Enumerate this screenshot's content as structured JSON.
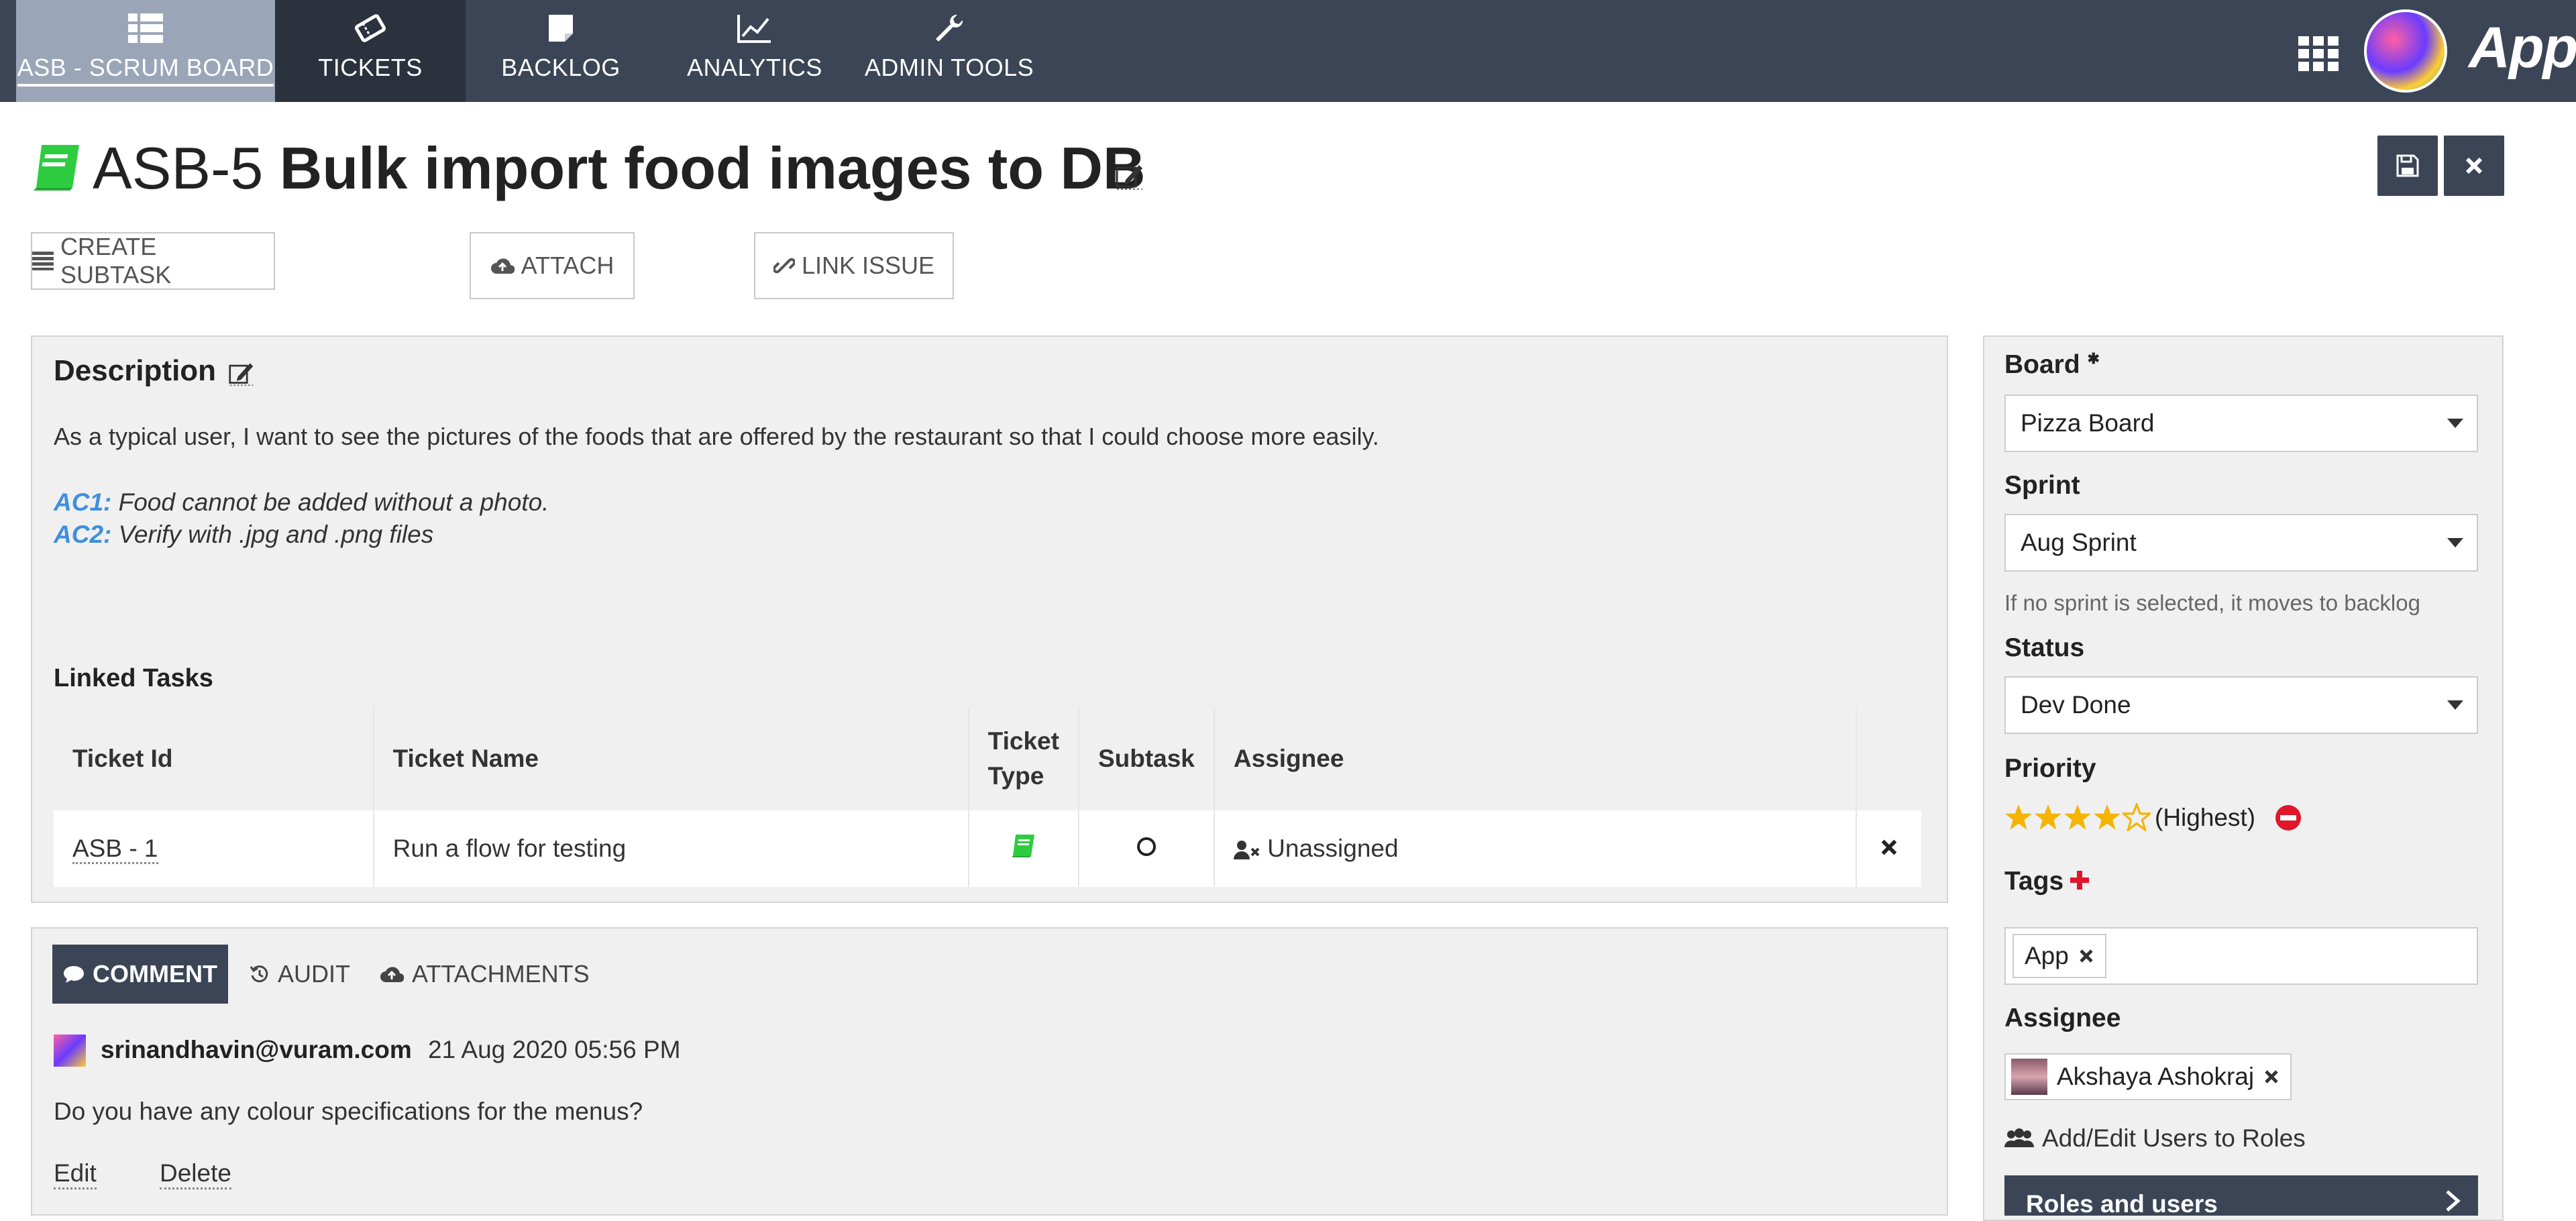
{
  "nav": {
    "items": [
      {
        "label": "ASB - SCRUM BOARD",
        "icon": "list-grid-icon"
      },
      {
        "label": "TICKETS",
        "icon": "ticket-icon"
      },
      {
        "label": "BACKLOG",
        "icon": "note-icon"
      },
      {
        "label": "ANALYTICS",
        "icon": "line-chart-icon"
      },
      {
        "label": "ADMIN TOOLS",
        "icon": "wrench-icon"
      }
    ],
    "brand": "Appia"
  },
  "ticket": {
    "id": "ASB-5",
    "name": "Bulk import food images to DB"
  },
  "actions": {
    "create_subtask": "CREATE SUBTASK",
    "attach": "ATTACH",
    "link_issue": "LINK ISSUE"
  },
  "description": {
    "heading": "Description",
    "text": "As a typical user, I want to see the pictures of the foods that are offered by the restaurant so that I could choose more easily.",
    "ac1_label": "AC1:",
    "ac1_text": " Food cannot be added without a photo.",
    "ac2_label": "AC2:",
    "ac2_text": " Verify with .jpg and .png files"
  },
  "linked": {
    "heading": "Linked Tasks",
    "columns": [
      "Ticket Id",
      "Ticket Name",
      "Ticket Type",
      "Subtask",
      "Assignee"
    ],
    "rows": [
      {
        "id": "ASB - 1",
        "name": "Run a flow for testing",
        "assignee": "Unassigned"
      }
    ]
  },
  "comments": {
    "tabs": [
      "COMMENT",
      "AUDIT",
      "ATTACHMENTS"
    ],
    "user": "srinandhavin@vuram.com",
    "time": "21 Aug 2020 05:56 PM",
    "text": "Do you have any colour specifications for the menus?",
    "edit": "Edit",
    "delete": "Delete"
  },
  "side": {
    "board_label": "Board",
    "board_value": "Pizza Board",
    "sprint_label": "Sprint",
    "sprint_value": "Aug Sprint",
    "sprint_hint": "If no sprint is selected, it moves to backlog",
    "status_label": "Status",
    "status_value": "Dev Done",
    "priority_label": "Priority",
    "priority_stars": 4,
    "priority_max": 5,
    "priority_text": "(Highest)",
    "tags_label": "Tags",
    "tag": "App",
    "assignee_label": "Assignee",
    "assignee_value": "Akshaya Ashokraj",
    "roles_link": "Add/Edit Users to Roles",
    "roles_bar": "Roles and users"
  },
  "colors": {
    "nav_bg": "#3b4556",
    "accent_green": "#2ecc40",
    "link_blue": "#3f8fdc",
    "star": "#f5b400",
    "danger": "#e0162b"
  }
}
